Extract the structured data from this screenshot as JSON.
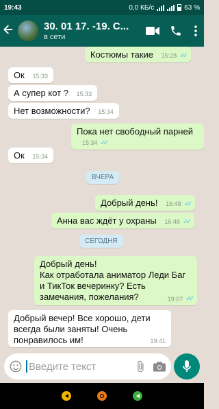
{
  "statusbar": {
    "time": "19:43",
    "net": "0,0 КБ/с",
    "battery": "63 %"
  },
  "header": {
    "title": "30. 01 17. -19. С...",
    "subtitle": "в сети"
  },
  "messages": [
    {
      "text": "Костюмы такие",
      "time": "15:28",
      "dir": "out"
    },
    {
      "text": "Ок",
      "time": "15:33",
      "dir": "in"
    },
    {
      "text": "А супер кот ?",
      "time": "15:33",
      "dir": "in"
    },
    {
      "text": "Нет возможности?",
      "time": "15:34",
      "dir": "in"
    },
    {
      "text": "Пока нет свободный парней",
      "time": "15:34",
      "dir": "out"
    },
    {
      "text": "Ок",
      "time": "15:34",
      "dir": "in"
    },
    {
      "text": "Добрый день!",
      "time": "16:48",
      "dir": "out"
    },
    {
      "text": "Анна вас ждёт у охраны",
      "time": "16:48",
      "dir": "out"
    },
    {
      "text": "Добрый день!\nКак отработала аниматор Леди Баг и ТикТок вечеринку? Есть замечания, пожелания?",
      "time": "19:07",
      "dir": "out"
    },
    {
      "text": "Добрый вечер! Все хорошо, дети всегда были заняты! Очень понравилось им!",
      "time": "19:41",
      "dir": "in"
    }
  ],
  "date_chips": [
    "ВЧЕРА",
    "СЕГОДНЯ"
  ],
  "input": {
    "placeholder": "Введите текст"
  },
  "colors": {
    "header": "#075e54",
    "out_bubble": "#dcf8c6",
    "in_bubble": "#ffffff",
    "read_ticks": "#4fc3f7",
    "mic": "#00897b"
  },
  "icons": [
    "back-arrow-icon",
    "video-call-icon",
    "phone-icon",
    "menu-dots-icon",
    "emoji-icon",
    "attach-icon",
    "camera-icon",
    "mic-icon"
  ]
}
